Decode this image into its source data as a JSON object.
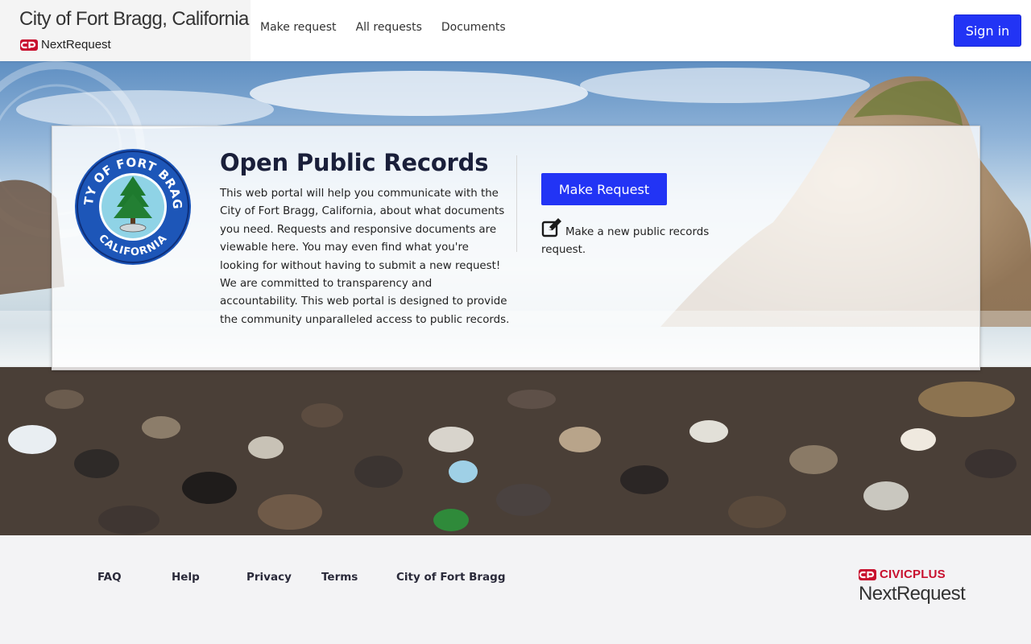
{
  "header": {
    "brand_title": "City of Fort Bragg, California",
    "brand_sub": "NextRequest",
    "brand_logo_icon": "civicplus-logo-icon",
    "nav": [
      {
        "label": "Make request"
      },
      {
        "label": "All requests"
      },
      {
        "label": "Documents"
      }
    ],
    "sign_in_label": "Sign in"
  },
  "hero": {
    "seal": {
      "top_text": "CITY OF FORT BRAGG",
      "bottom_text": "CALIFORNIA"
    },
    "title": "Open Public Records",
    "description": "This web portal will help you communicate with the City of Fort Bragg, California, about what documents you need. Requests and responsive documents are viewable here. You may even find what you're looking for without having to submit a new request! We are committed to transparency and accountability. This web portal is designed to provide the community unparalleled access to public records.",
    "make_request_label": "Make Request",
    "make_request_note": "Make a new public records request.",
    "note_icon": "edit-icon"
  },
  "footer": {
    "links": [
      {
        "label": "FAQ"
      },
      {
        "label": "Help"
      },
      {
        "label": "Privacy"
      },
      {
        "label": "Terms"
      },
      {
        "label": "City of Fort Bragg"
      }
    ],
    "civic_brand": "CIVIC",
    "civic_brand_plus": "PLUS",
    "product": "NextRequest"
  },
  "colors": {
    "accent": "#2234f5",
    "brand_red": "#c8102e",
    "footer_bg": "#f3f3f5"
  }
}
